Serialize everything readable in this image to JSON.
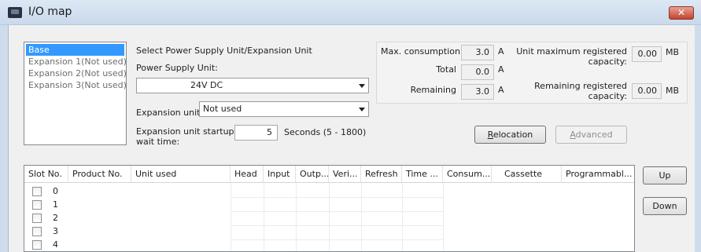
{
  "window": {
    "title": "I/O map",
    "close_icon": "close-icon"
  },
  "expansion_list": {
    "items": [
      "Base",
      "Expansion 1(Not used)",
      "Expansion 2(Not used)",
      "Expansion 3(Not used)"
    ],
    "selected": "Base"
  },
  "unit_settings": {
    "heading": "Select Power Supply Unit/Expansion Unit",
    "power_supply_label": "Power Supply Unit:",
    "power_supply_value": "24V DC",
    "expansion_unit_label": "Expansion unit:",
    "expansion_unit_value": "Not used",
    "startup_wait_label_line1": "Expansion unit startup",
    "startup_wait_label_line2": "wait time:",
    "startup_wait_value": "5",
    "startup_wait_unit": "Seconds (5 - 1800)"
  },
  "consumption": {
    "max_label": "Max. consumption",
    "max_value": "3.0",
    "total_label": "Total",
    "total_value": "0.0",
    "remaining_label": "Remaining",
    "remaining_value": "3.0",
    "unit": "A",
    "unit_max_capacity_label_line1": "Unit maximum registered",
    "unit_max_capacity_label_line2": "capacity:",
    "unit_max_capacity_value": "0.00",
    "remaining_capacity_label_line1": "Remaining registered",
    "remaining_capacity_label_line2": "capacity:",
    "remaining_capacity_value": "0.00",
    "capacity_unit": "MB"
  },
  "buttons": {
    "relocation_prefix": "R",
    "relocation_rest": "elocation",
    "advanced_prefix": "A",
    "advanced_rest": "dvanced",
    "up": "Up",
    "down": "Down"
  },
  "slot_table": {
    "headers": [
      "Slot No.",
      "Product No.",
      "Unit used",
      "Head",
      "Input",
      "Outp...",
      "Veri...",
      "Refresh",
      "Time ...",
      "Consum...",
      "Cassette",
      "Programmabl..."
    ],
    "slots": [
      "0",
      "1",
      "2",
      "3",
      "4"
    ]
  }
}
